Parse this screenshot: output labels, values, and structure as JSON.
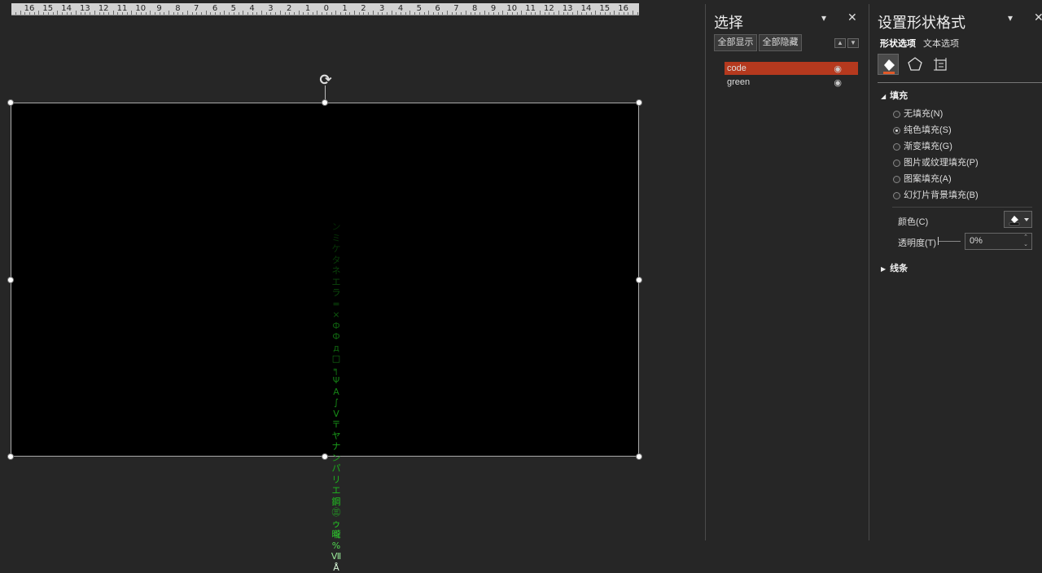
{
  "ruler": {
    "labels": [
      "16",
      "15",
      "14",
      "13",
      "12",
      "11",
      "10",
      "9",
      "8",
      "7",
      "6",
      "5",
      "4",
      "3",
      "2",
      "1",
      "0",
      "1",
      "2",
      "3",
      "4",
      "5",
      "6",
      "7",
      "8",
      "9",
      "10",
      "11",
      "12",
      "13",
      "14",
      "15",
      "16"
    ]
  },
  "slide": {
    "code_glyphs": [
      "ン",
      "ミ",
      "ケ",
      "タ",
      "ネ",
      "エ",
      "ラ",
      "=",
      "×",
      "Ф",
      "Ф",
      "д",
      "□",
      "╕",
      "Ψ",
      "A",
      "∫",
      "V",
      "〒",
      "ヤ",
      "ナ",
      "ン",
      "パ",
      "リ",
      "エ",
      "鋼",
      "㊂",
      "ゥ",
      "曨",
      "%",
      "Ⅶ",
      "Å"
    ],
    "glyph_colors": [
      "#052a05",
      "#063006",
      "#073507",
      "#083a08",
      "#0a400a",
      "#0b460b",
      "#0c4c0c",
      "#0d520d",
      "#0e580e",
      "#0f5e0f",
      "#106410",
      "#116a11",
      "#127012",
      "#137613",
      "#147c14",
      "#158215",
      "#168816",
      "#178e17",
      "#189418",
      "#199a19",
      "#1aa01a",
      "#1ba61b",
      "#1cac1c",
      "#1db21d",
      "#1eb81e",
      "#20be20",
      "#22c422",
      "#24ca24",
      "#2ed02e",
      "#50d850",
      "#9aea9a",
      "#d8f6d8"
    ]
  },
  "selection_pane": {
    "title": "选择",
    "show_all": "全部显示",
    "hide_all": "全部隐藏",
    "layers": [
      {
        "name": "code",
        "selected": true
      },
      {
        "name": "green",
        "selected": false
      }
    ]
  },
  "format_pane": {
    "title": "设置形状格式",
    "tab_shape": "形状选项",
    "tab_text": "文本选项",
    "fill_section": "填充",
    "fill_options": [
      {
        "label": "无填充(N)",
        "checked": false
      },
      {
        "label": "纯色填充(S)",
        "checked": true
      },
      {
        "label": "渐变填充(G)",
        "checked": false
      },
      {
        "label": "图片或纹理填充(P)",
        "checked": false
      },
      {
        "label": "图案填充(A)",
        "checked": false
      },
      {
        "label": "幻灯片背景填充(B)",
        "checked": false
      }
    ],
    "color_label": "颜色(C)",
    "transparency_label": "透明度(T)",
    "transparency_value": "0%",
    "line_section": "线条"
  },
  "colors": {
    "accent_selected": "#b5391e",
    "background": "#262626"
  }
}
